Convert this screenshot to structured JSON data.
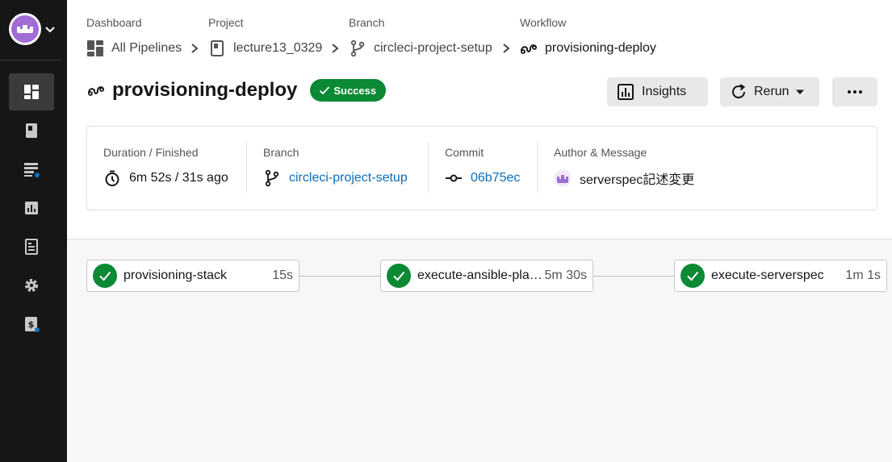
{
  "sidebar": {
    "org_icon": "circleci-org-logo",
    "items": [
      {
        "icon": "dashboard-icon",
        "active": true
      },
      {
        "icon": "projects-icon"
      },
      {
        "icon": "plans-icon",
        "dot": true
      },
      {
        "icon": "insights-icon"
      },
      {
        "icon": "docs-icon"
      },
      {
        "icon": "settings-icon"
      },
      {
        "icon": "billing-icon",
        "dot": true
      }
    ]
  },
  "breadcrumb": {
    "dashboard": {
      "label": "Dashboard",
      "value": "All Pipelines"
    },
    "project": {
      "label": "Project",
      "value": "lecture13_0329"
    },
    "branch": {
      "label": "Branch",
      "value": "circleci-project-setup"
    },
    "workflow": {
      "label": "Workflow",
      "value": "provisioning-deploy"
    }
  },
  "workflow": {
    "title": "provisioning-deploy",
    "status": "Success"
  },
  "actions": {
    "insights": "Insights",
    "rerun": "Rerun"
  },
  "summary": {
    "duration": {
      "label": "Duration / Finished",
      "value": "6m 52s / 31s ago"
    },
    "branch": {
      "label": "Branch",
      "value": "circleci-project-setup"
    },
    "commit": {
      "label": "Commit",
      "value": "06b75ec"
    },
    "author": {
      "label": "Author & Message",
      "value": "serverspec記述変更"
    }
  },
  "jobs": [
    {
      "name": "provisioning-stack",
      "duration": "15s",
      "status": "success"
    },
    {
      "name": "execute-ansible-playbook",
      "duration": "5m 30s",
      "status": "success"
    },
    {
      "name": "execute-serverspec",
      "duration": "1m 1s",
      "status": "success"
    }
  ],
  "colors": {
    "success": "#0b8934",
    "link": "#0a6ebd",
    "sidebar": "#161616",
    "notify_dot": "#0a6ebd"
  }
}
